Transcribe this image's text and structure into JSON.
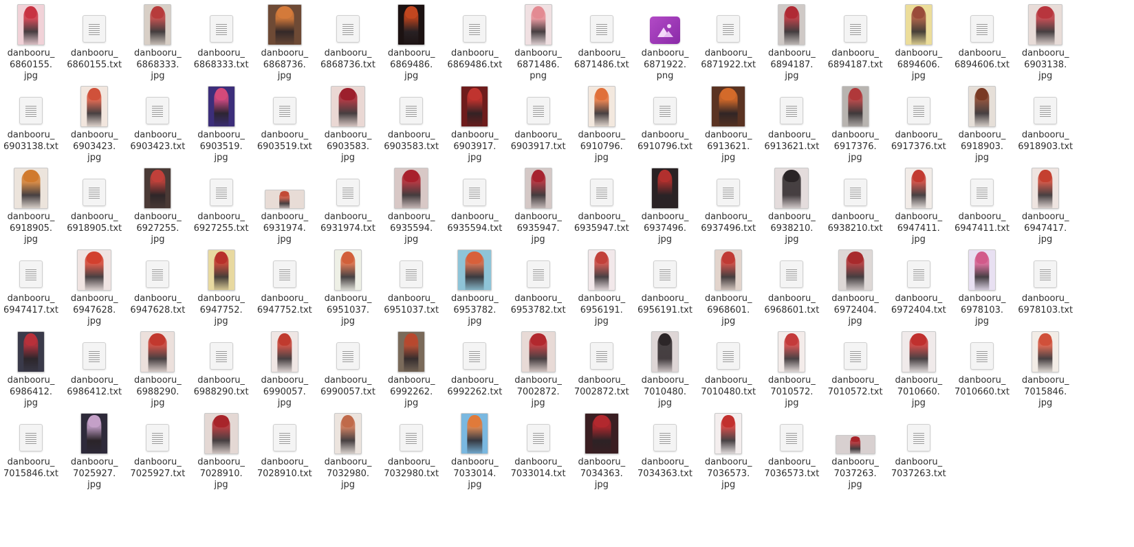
{
  "files": [
    {
      "name": "danbooru_\n6860155.\njpg",
      "kind": "image",
      "colors": [
        "#f1d2d8",
        "#c83242"
      ]
    },
    {
      "name": "danbooru_\n6860155.txt",
      "kind": "text"
    },
    {
      "name": "danbooru_\n6868333.\njpg",
      "kind": "image",
      "colors": [
        "#d8cfc6",
        "#b73b3b"
      ]
    },
    {
      "name": "danbooru_\n6868333.txt",
      "kind": "text"
    },
    {
      "name": "danbooru_\n6868736.\njpg",
      "kind": "image",
      "colors": [
        "#6e4a35",
        "#d47a3a"
      ]
    },
    {
      "name": "danbooru_\n6868736.txt",
      "kind": "text"
    },
    {
      "name": "danbooru_\n6869486.\njpg",
      "kind": "image",
      "colors": [
        "#1c1212",
        "#c2461f"
      ]
    },
    {
      "name": "danbooru_\n6869486.txt",
      "kind": "text"
    },
    {
      "name": "danbooru_\n6871486.\npng",
      "kind": "image",
      "colors": [
        "#f0e0e2",
        "#e38a92"
      ]
    },
    {
      "name": "danbooru_\n6871486.txt",
      "kind": "text"
    },
    {
      "name": "danbooru_\n6871922.\npng",
      "kind": "generic-image"
    },
    {
      "name": "danbooru_\n6871922.txt",
      "kind": "text"
    },
    {
      "name": "danbooru_\n6894187.\njpg",
      "kind": "image",
      "colors": [
        "#cfc9c6",
        "#b02a34"
      ]
    },
    {
      "name": "danbooru_\n6894187.txt",
      "kind": "text"
    },
    {
      "name": "danbooru_\n6894606.\njpg",
      "kind": "image",
      "colors": [
        "#ecdd9a",
        "#9a4b3a"
      ]
    },
    {
      "name": "danbooru_\n6894606.txt",
      "kind": "text"
    },
    {
      "name": "danbooru_\n6903138.\njpg",
      "kind": "image",
      "colors": [
        "#e8dcd8",
        "#b8353d"
      ]
    },
    {
      "name": "danbooru_\n6903138.txt",
      "kind": "text"
    },
    {
      "name": "danbooru_\n6903423.\njpg",
      "kind": "image",
      "colors": [
        "#f2e6de",
        "#d0513a"
      ]
    },
    {
      "name": "danbooru_\n6903423.txt",
      "kind": "text"
    },
    {
      "name": "danbooru_\n6903519.\njpg",
      "kind": "image",
      "colors": [
        "#3c2e7a",
        "#d44a7a"
      ]
    },
    {
      "name": "danbooru_\n6903519.txt",
      "kind": "text"
    },
    {
      "name": "danbooru_\n6903583.\njpg",
      "kind": "image",
      "colors": [
        "#ead8d4",
        "#9c1f2c"
      ]
    },
    {
      "name": "danbooru_\n6903583.txt",
      "kind": "text"
    },
    {
      "name": "danbooru_\n6903917.\njpg",
      "kind": "image",
      "colors": [
        "#6e1c1c",
        "#c0342f"
      ]
    },
    {
      "name": "danbooru_\n6903917.txt",
      "kind": "text"
    },
    {
      "name": "danbooru_\n6910796.\njpg",
      "kind": "image",
      "colors": [
        "#f3e8de",
        "#e0703a"
      ]
    },
    {
      "name": "danbooru_\n6910796.txt",
      "kind": "text"
    },
    {
      "name": "danbooru_\n6913621.\njpg",
      "kind": "image",
      "colors": [
        "#5a3322",
        "#d36a2a"
      ]
    },
    {
      "name": "danbooru_\n6913621.txt",
      "kind": "text"
    },
    {
      "name": "danbooru_\n6917376.\njpg",
      "kind": "image",
      "colors": [
        "#b8b4b0",
        "#b0383a"
      ]
    },
    {
      "name": "danbooru_\n6917376.txt",
      "kind": "text"
    },
    {
      "name": "danbooru_\n6918903.\njpg",
      "kind": "image",
      "colors": [
        "#e6dfd8",
        "#7a3a24"
      ]
    },
    {
      "name": "danbooru_\n6918903.txt",
      "kind": "text"
    },
    {
      "name": "danbooru_\n6918905.\njpg",
      "kind": "image",
      "colors": [
        "#ece4dc",
        "#d07a2e"
      ]
    },
    {
      "name": "danbooru_\n6918905.txt",
      "kind": "text"
    },
    {
      "name": "danbooru_\n6927255.\njpg",
      "kind": "image",
      "colors": [
        "#4a3a36",
        "#c1403a"
      ]
    },
    {
      "name": "danbooru_\n6927255.txt",
      "kind": "text"
    },
    {
      "name": "danbooru_\n6931974.\njpg",
      "kind": "image",
      "wide": true,
      "colors": [
        "#e8dcd6",
        "#c24a36"
      ]
    },
    {
      "name": "danbooru_\n6931974.txt",
      "kind": "text"
    },
    {
      "name": "danbooru_\n6935594.\njpg",
      "kind": "image",
      "colors": [
        "#d8c8c6",
        "#a8202c"
      ]
    },
    {
      "name": "danbooru_\n6935594.txt",
      "kind": "text"
    },
    {
      "name": "danbooru_\n6935947.\njpg",
      "kind": "image",
      "colors": [
        "#d4c8c6",
        "#a6222e"
      ]
    },
    {
      "name": "danbooru_\n6935947.txt",
      "kind": "text"
    },
    {
      "name": "danbooru_\n6937496.\njpg",
      "kind": "image",
      "colors": [
        "#2a2224",
        "#b2302e"
      ]
    },
    {
      "name": "danbooru_\n6937496.txt",
      "kind": "text"
    },
    {
      "name": "danbooru_\n6938210.\njpg",
      "kind": "image",
      "colors": [
        "#e4dcdc",
        "#2a2426"
      ]
    },
    {
      "name": "danbooru_\n6938210.txt",
      "kind": "text"
    },
    {
      "name": "danbooru_\n6947411.\njpg",
      "kind": "image",
      "colors": [
        "#f2ece8",
        "#c23a30"
      ]
    },
    {
      "name": "danbooru_\n6947411.txt",
      "kind": "text"
    },
    {
      "name": "danbooru_\n6947417.\njpg",
      "kind": "image",
      "colors": [
        "#eee4e0",
        "#c44030"
      ]
    },
    {
      "name": "danbooru_\n6947417.txt",
      "kind": "text"
    },
    {
      "name": "danbooru_\n6947628.\njpg",
      "kind": "image",
      "colors": [
        "#f0e4e2",
        "#d2402e"
      ]
    },
    {
      "name": "danbooru_\n6947628.txt",
      "kind": "text"
    },
    {
      "name": "danbooru_\n6947752.\njpg",
      "kind": "image",
      "colors": [
        "#e8d9a0",
        "#b8302a"
      ]
    },
    {
      "name": "danbooru_\n6947752.txt",
      "kind": "text"
    },
    {
      "name": "danbooru_\n6951037.\njpg",
      "kind": "image",
      "colors": [
        "#eef0e6",
        "#d2603a"
      ]
    },
    {
      "name": "danbooru_\n6951037.txt",
      "kind": "text"
    },
    {
      "name": "danbooru_\n6953782.\njpg",
      "kind": "image",
      "colors": [
        "#8ec4d8",
        "#d8603a"
      ]
    },
    {
      "name": "danbooru_\n6953782.txt",
      "kind": "text"
    },
    {
      "name": "danbooru_\n6956191.\njpg",
      "kind": "image",
      "colors": [
        "#f2e8ea",
        "#c2403a"
      ]
    },
    {
      "name": "danbooru_\n6956191.txt",
      "kind": "text"
    },
    {
      "name": "danbooru_\n6968601.\njpg",
      "kind": "image",
      "colors": [
        "#e2d4cc",
        "#c03a34"
      ]
    },
    {
      "name": "danbooru_\n6968601.txt",
      "kind": "text"
    },
    {
      "name": "danbooru_\n6972404.\njpg",
      "kind": "image",
      "colors": [
        "#ded8d6",
        "#a82a2c"
      ]
    },
    {
      "name": "danbooru_\n6972404.txt",
      "kind": "text"
    },
    {
      "name": "danbooru_\n6978103.\njpg",
      "kind": "image",
      "colors": [
        "#e8e0f2",
        "#d25a8a"
      ]
    },
    {
      "name": "danbooru_\n6978103.txt",
      "kind": "text"
    },
    {
      "name": "danbooru_\n6986412.\njpg",
      "kind": "image",
      "colors": [
        "#3a3a4a",
        "#b8303a"
      ]
    },
    {
      "name": "danbooru_\n6986412.txt",
      "kind": "text"
    },
    {
      "name": "danbooru_\n6988290.\njpg",
      "kind": "image",
      "colors": [
        "#ece0dc",
        "#c2382e"
      ]
    },
    {
      "name": "danbooru_\n6988290.txt",
      "kind": "text"
    },
    {
      "name": "danbooru_\n6990057.\njpg",
      "kind": "image",
      "colors": [
        "#efe6e4",
        "#c03a2e"
      ]
    },
    {
      "name": "danbooru_\n6990057.txt",
      "kind": "text"
    },
    {
      "name": "danbooru_\n6992262.\njpg",
      "kind": "image",
      "colors": [
        "#7a6a5a",
        "#b8482e"
      ]
    },
    {
      "name": "danbooru_\n6992262.txt",
      "kind": "text"
    },
    {
      "name": "danbooru_\n7002872.\njpg",
      "kind": "image",
      "colors": [
        "#e8dad6",
        "#b2282e"
      ]
    },
    {
      "name": "danbooru_\n7002872.txt",
      "kind": "text"
    },
    {
      "name": "danbooru_\n7010480.\njpg",
      "kind": "image",
      "colors": [
        "#ded6d6",
        "#2c2628"
      ]
    },
    {
      "name": "danbooru_\n7010480.txt",
      "kind": "text"
    },
    {
      "name": "danbooru_\n7010572.\njpg",
      "kind": "image",
      "colors": [
        "#f4ecea",
        "#c43a3a"
      ]
    },
    {
      "name": "danbooru_\n7010572.txt",
      "kind": "text"
    },
    {
      "name": "danbooru_\n7010660.\njpg",
      "kind": "image",
      "colors": [
        "#f0eaea",
        "#c0302e"
      ]
    },
    {
      "name": "danbooru_\n7010660.txt",
      "kind": "text"
    },
    {
      "name": "danbooru_\n7015846.\njpg",
      "kind": "image",
      "colors": [
        "#f2ece6",
        "#d0503a"
      ]
    },
    {
      "name": "danbooru_\n7015846.txt",
      "kind": "text"
    },
    {
      "name": "danbooru_\n7025927.\njpg",
      "kind": "image",
      "colors": [
        "#2e2a3a",
        "#c4a0c8"
      ]
    },
    {
      "name": "danbooru_\n7025927.txt",
      "kind": "text"
    },
    {
      "name": "danbooru_\n7028910.\njpg",
      "kind": "image",
      "colors": [
        "#e4d8d4",
        "#a8242a"
      ]
    },
    {
      "name": "danbooru_\n7028910.txt",
      "kind": "text"
    },
    {
      "name": "danbooru_\n7032980.\njpg",
      "kind": "image",
      "colors": [
        "#ece4de",
        "#c06a4a"
      ]
    },
    {
      "name": "danbooru_\n7032980.txt",
      "kind": "text"
    },
    {
      "name": "danbooru_\n7033014.\njpg",
      "kind": "image",
      "colors": [
        "#7ab8e0",
        "#e07a3a"
      ]
    },
    {
      "name": "danbooru_\n7033014.txt",
      "kind": "text"
    },
    {
      "name": "danbooru_\n7034363.\njpg",
      "kind": "image",
      "colors": [
        "#3a1e22",
        "#b2282e"
      ]
    },
    {
      "name": "danbooru_\n7034363.txt",
      "kind": "text"
    },
    {
      "name": "danbooru_\n7036573.\njpg",
      "kind": "image",
      "colors": [
        "#f4eeee",
        "#c2302e"
      ]
    },
    {
      "name": "danbooru_\n7036573.txt",
      "kind": "text"
    },
    {
      "name": "danbooru_\n7037263.\njpg",
      "kind": "image",
      "wide": true,
      "colors": [
        "#d8d0d0",
        "#a8242a"
      ]
    },
    {
      "name": "danbooru_\n7037263.txt",
      "kind": "text"
    }
  ]
}
